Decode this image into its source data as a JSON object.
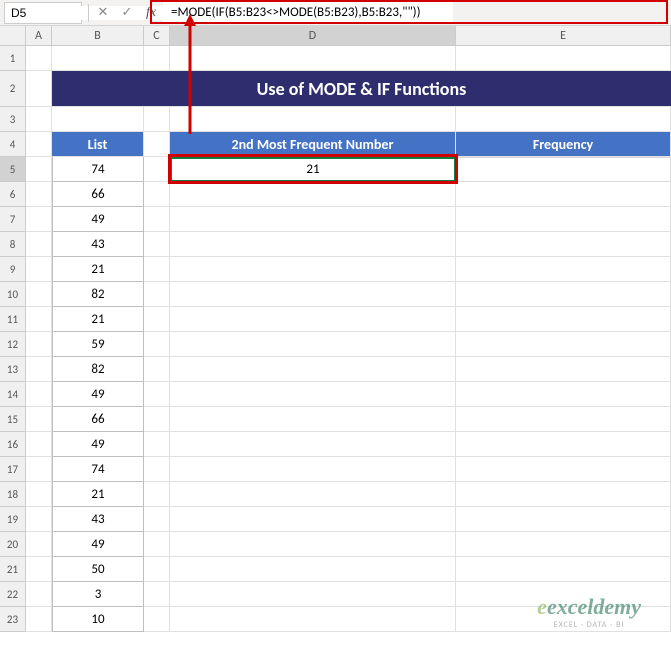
{
  "formula_bar": {
    "cell_ref": "D5",
    "formula": "=MODE(IF(B5:B23<>MODE(B5:B23),B5:B23,\"\"))"
  },
  "columns": [
    "A",
    "B",
    "C",
    "D",
    "E"
  ],
  "rows": [
    "1",
    "2",
    "3",
    "4",
    "5",
    "6",
    "7",
    "8",
    "9",
    "10",
    "11",
    "12",
    "13",
    "14",
    "15",
    "16",
    "17",
    "18",
    "19",
    "20",
    "21",
    "22",
    "23"
  ],
  "title": "Use of MODE & IF Functions",
  "headers": {
    "list": "List",
    "second": "2nd Most Frequent Number",
    "freq": "Frequency"
  },
  "list_values": [
    "74",
    "66",
    "49",
    "43",
    "21",
    "82",
    "21",
    "59",
    "82",
    "49",
    "66",
    "49",
    "74",
    "21",
    "43",
    "49",
    "50",
    "3",
    "10"
  ],
  "result_value": "21",
  "watermark": {
    "brand": "exceldemy",
    "sub": "EXCEL · DATA · BI"
  },
  "chart_data": {
    "type": "table",
    "title": "Use of MODE & IF Functions",
    "list": [
      74,
      66,
      49,
      43,
      21,
      82,
      21,
      59,
      82,
      49,
      66,
      49,
      74,
      21,
      43,
      49,
      50,
      3,
      10
    ],
    "second_most_frequent_number": 21,
    "frequency": null,
    "formula": "=MODE(IF(B5:B23<>MODE(B5:B23),B5:B23,\"\"))"
  }
}
